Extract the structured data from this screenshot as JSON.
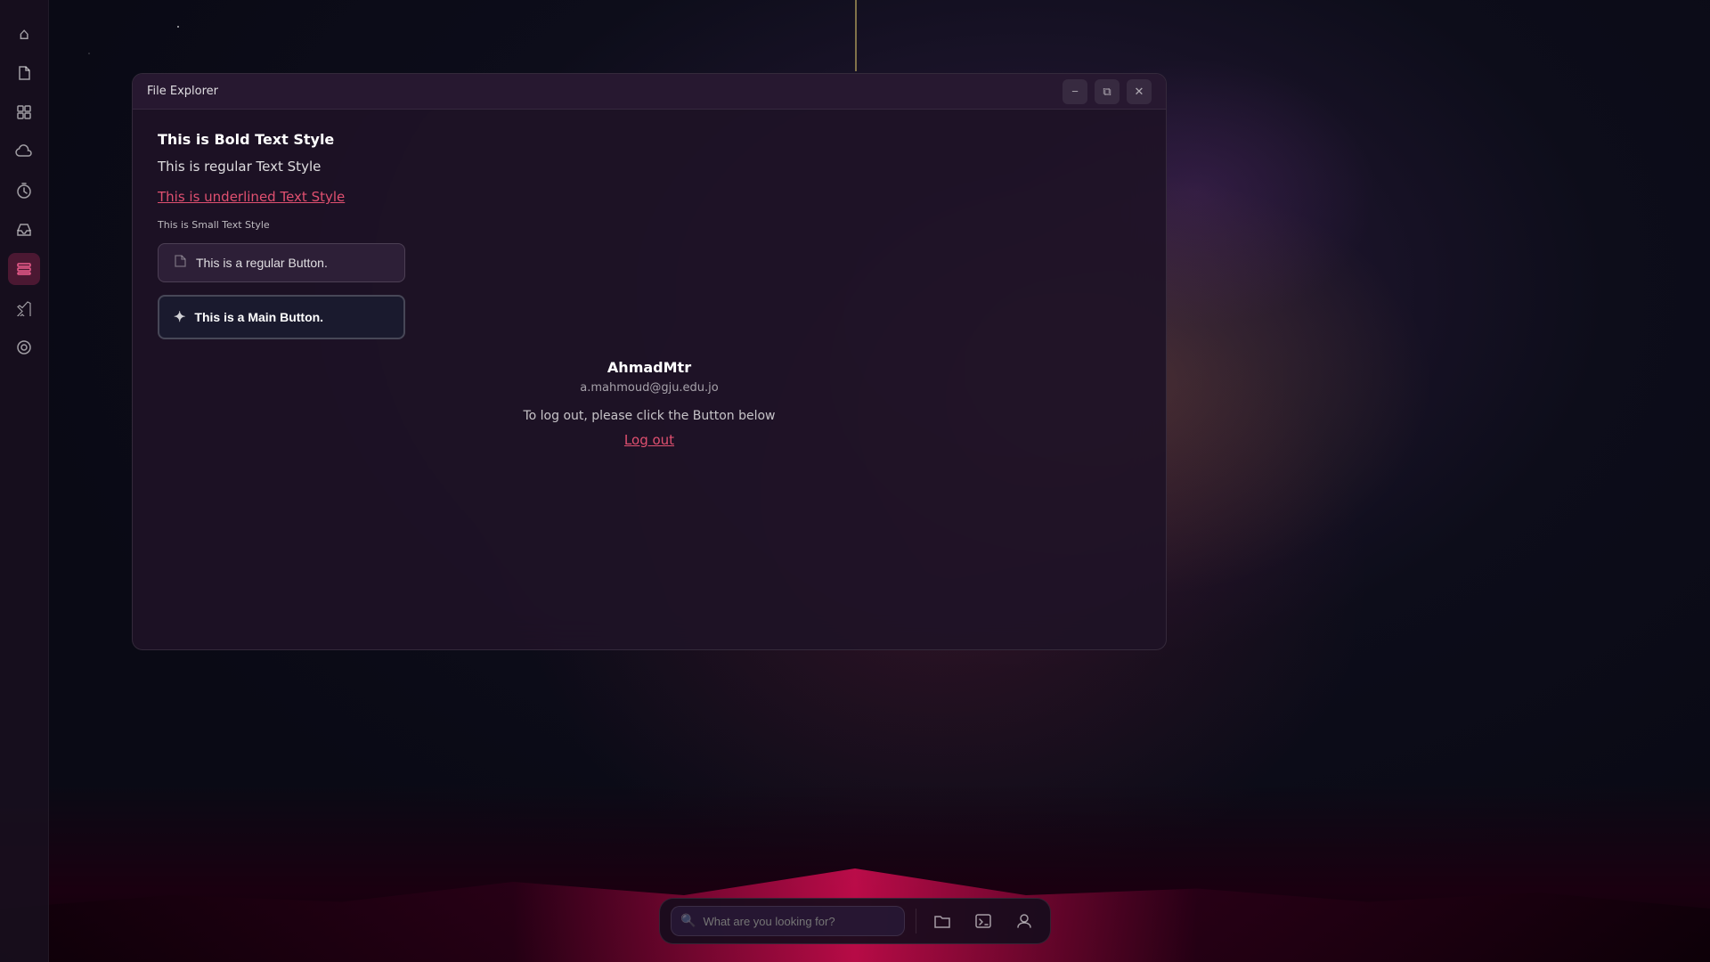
{
  "window": {
    "title": "File Explorer",
    "controls": {
      "minimize": "−",
      "maximize": "⧉",
      "close": "✕"
    }
  },
  "content": {
    "bold_text": "This is Bold Text Style",
    "regular_text": "This is regular Text Style",
    "underlined_text": "This is underlined Text Style",
    "small_text": "This is Small Text Style",
    "btn_regular_label": "This is a regular Button.",
    "btn_main_label": "This is a Main Button."
  },
  "user": {
    "username": "AhmadMtr",
    "email": "a.mahmoud@gju.edu.jo",
    "logout_info": "To log out, please click the Button below",
    "logout_label": "Log out"
  },
  "taskbar": {
    "search_placeholder": "What are you looking for?",
    "folder_icon": "🗁",
    "terminal_icon": ">_",
    "user_icon": "👤"
  },
  "sidebar": {
    "items": [
      {
        "name": "home",
        "icon": "⌂"
      },
      {
        "name": "documents",
        "icon": "📄"
      },
      {
        "name": "grid",
        "icon": "⊞"
      },
      {
        "name": "cloud",
        "icon": "☁"
      },
      {
        "name": "timer",
        "icon": "◷"
      },
      {
        "name": "inbox",
        "icon": "⊿"
      },
      {
        "name": "layers",
        "icon": "▣"
      },
      {
        "name": "code",
        "icon": "⟨⟩"
      },
      {
        "name": "package",
        "icon": "◈"
      }
    ]
  },
  "colors": {
    "accent": "#e05070",
    "bg_dark": "#1a0f22",
    "text_dim": "rgba(255,255,255,0.6)"
  }
}
